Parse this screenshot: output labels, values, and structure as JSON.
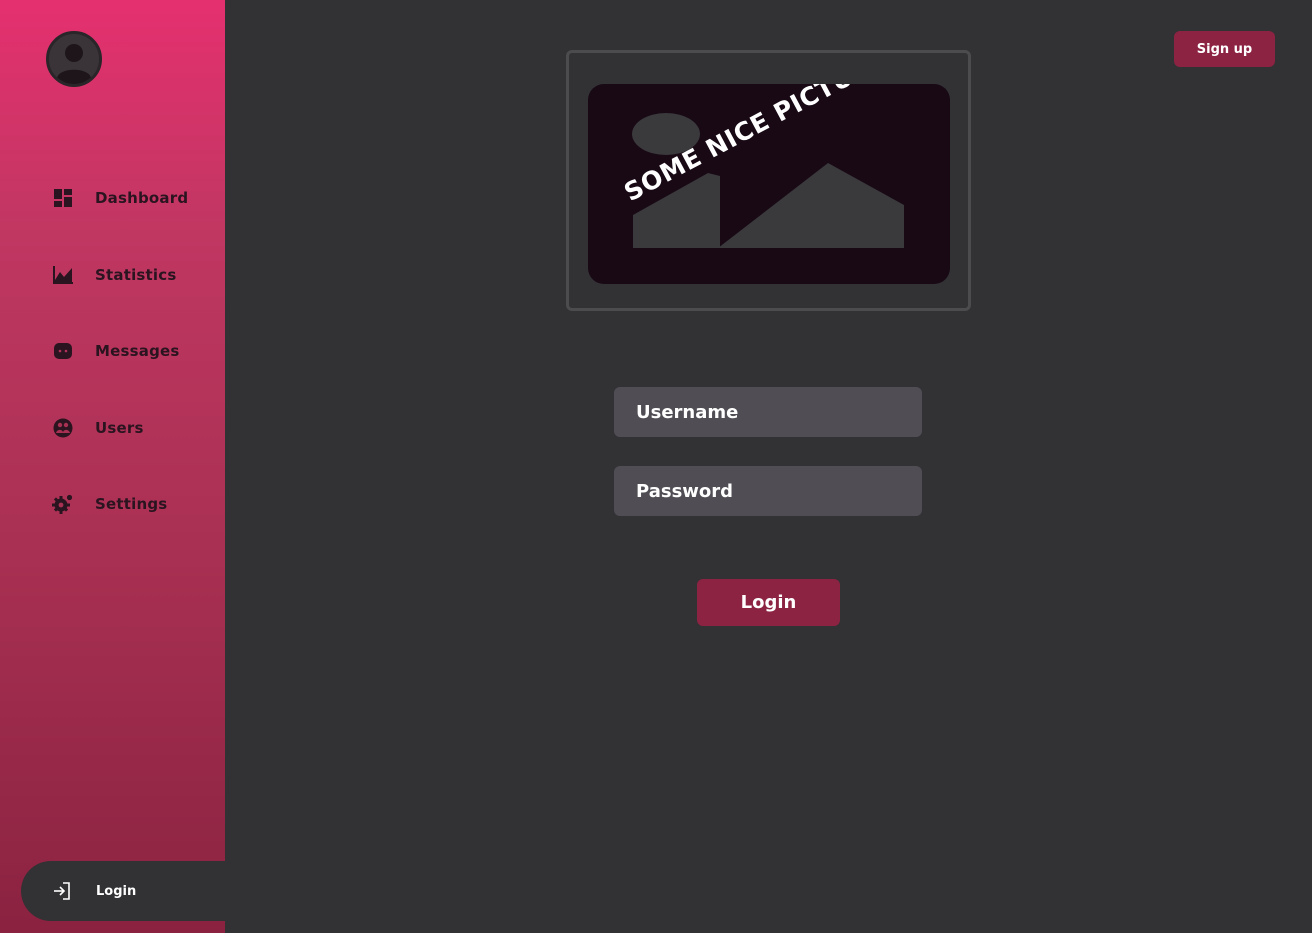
{
  "sidebar": {
    "avatar_icon": "user-avatar-icon",
    "items": [
      {
        "label": "Dashboard",
        "icon": "dashboard-icon"
      },
      {
        "label": "Statistics",
        "icon": "statistics-icon"
      },
      {
        "label": "Messages",
        "icon": "messages-icon"
      },
      {
        "label": "Users",
        "icon": "users-icon"
      },
      {
        "label": "Settings",
        "icon": "settings-icon"
      }
    ],
    "login": {
      "label": "Login",
      "icon": "login-icon"
    }
  },
  "header": {
    "signup_label": "Sign up"
  },
  "hero": {
    "caption": "SOME NICE PICTURE",
    "icon": "image-placeholder-icon"
  },
  "form": {
    "username_placeholder": "Username",
    "password_placeholder": "Password",
    "login_label": "Login"
  },
  "colors": {
    "sidebar_top": "#e5306f",
    "sidebar_bottom": "#8a2240",
    "background": "#323134",
    "accent": "#8c2343",
    "field": "#504e54"
  }
}
